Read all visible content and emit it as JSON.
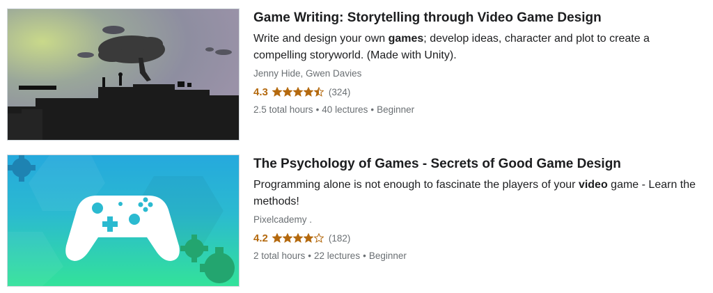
{
  "courses": [
    {
      "title": "Game Writing: Storytelling through Video Game Design",
      "description": {
        "before": "Write and design your own ",
        "bold": "games",
        "after": "; develop ideas, character and plot to create a compelling storyworld. (Made with Unity)."
      },
      "authors": "Jenny Hide, Gwen Davies",
      "rating": "4.3",
      "rating_value": 4.3,
      "reviews": "(324)",
      "hours": "2.5 total hours",
      "lectures": "40 lectures",
      "level": "Beginner",
      "thumbnail_icon": "silhouette-tree-landscape"
    },
    {
      "title": "The Psychology of Games - Secrets of Good Game Design",
      "description": {
        "before": "Programming alone is not enough to fascinate the players of your ",
        "bold": "video",
        "after": " game - Learn the methods!"
      },
      "authors": "Pixelcademy .",
      "rating": "4.2",
      "rating_value": 4.2,
      "reviews": "(182)",
      "hours": "2 total hours",
      "lectures": "22 lectures",
      "level": "Beginner",
      "thumbnail_icon": "game-controller"
    }
  ],
  "separator": "•",
  "colors": {
    "rating": "#b4690e",
    "muted": "#6a6f73",
    "title": "#1c1d1f",
    "teal": "#29b6d8",
    "green": "#2ee0a0"
  }
}
